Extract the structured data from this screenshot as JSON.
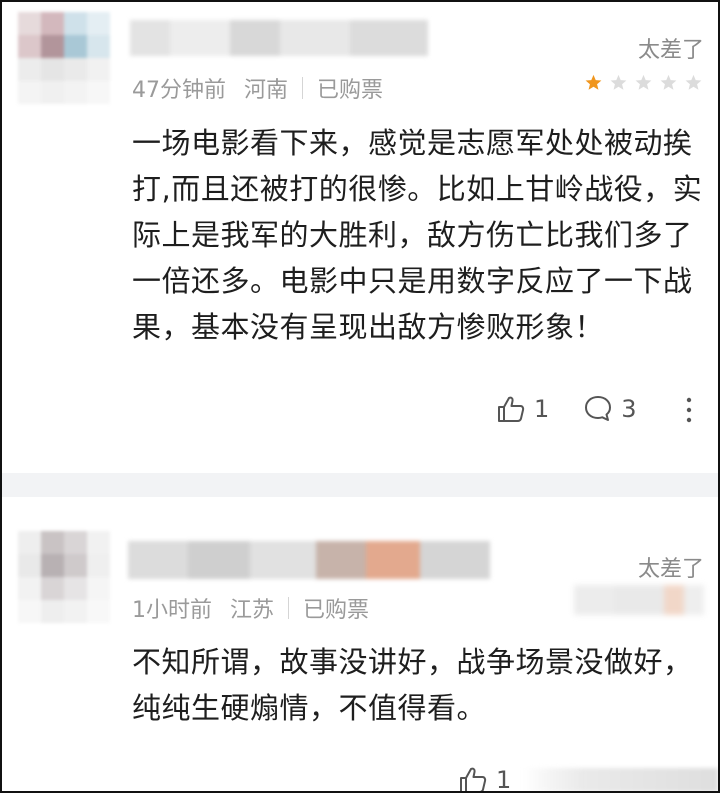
{
  "reviews": [
    {
      "rating_text": "太差了",
      "time": "47分钟前",
      "region": "河南",
      "purchase": "已购票",
      "stars_filled": 1,
      "stars_total": 5,
      "text": "一场电影看下来，感觉是志愿军处处被动挨打,而且还被打的很惨。比如上甘岭战役，实际上是我军的大胜利，敌方伤亡比我们多了一倍还多。电影中只是用数字反应了一下战果，基本没有呈现出敌方惨败形象！",
      "likes": "1",
      "comments": "3"
    },
    {
      "rating_text": "太差了",
      "time": "1小时前",
      "region": "江苏",
      "purchase": "已购票",
      "text": "不知所谓，故事没讲好，战争场景没做好，纯纯生硬煽情，不值得看。",
      "likes": "1"
    }
  ],
  "colors": {
    "star_filled": "#f0961e",
    "star_empty": "#dcdcdc",
    "divider": "#f2f3f5"
  },
  "icons": {
    "like": "thumbs-up-icon",
    "comment": "comment-bubble-icon",
    "more": "more-vertical-icon",
    "star": "star-icon"
  }
}
